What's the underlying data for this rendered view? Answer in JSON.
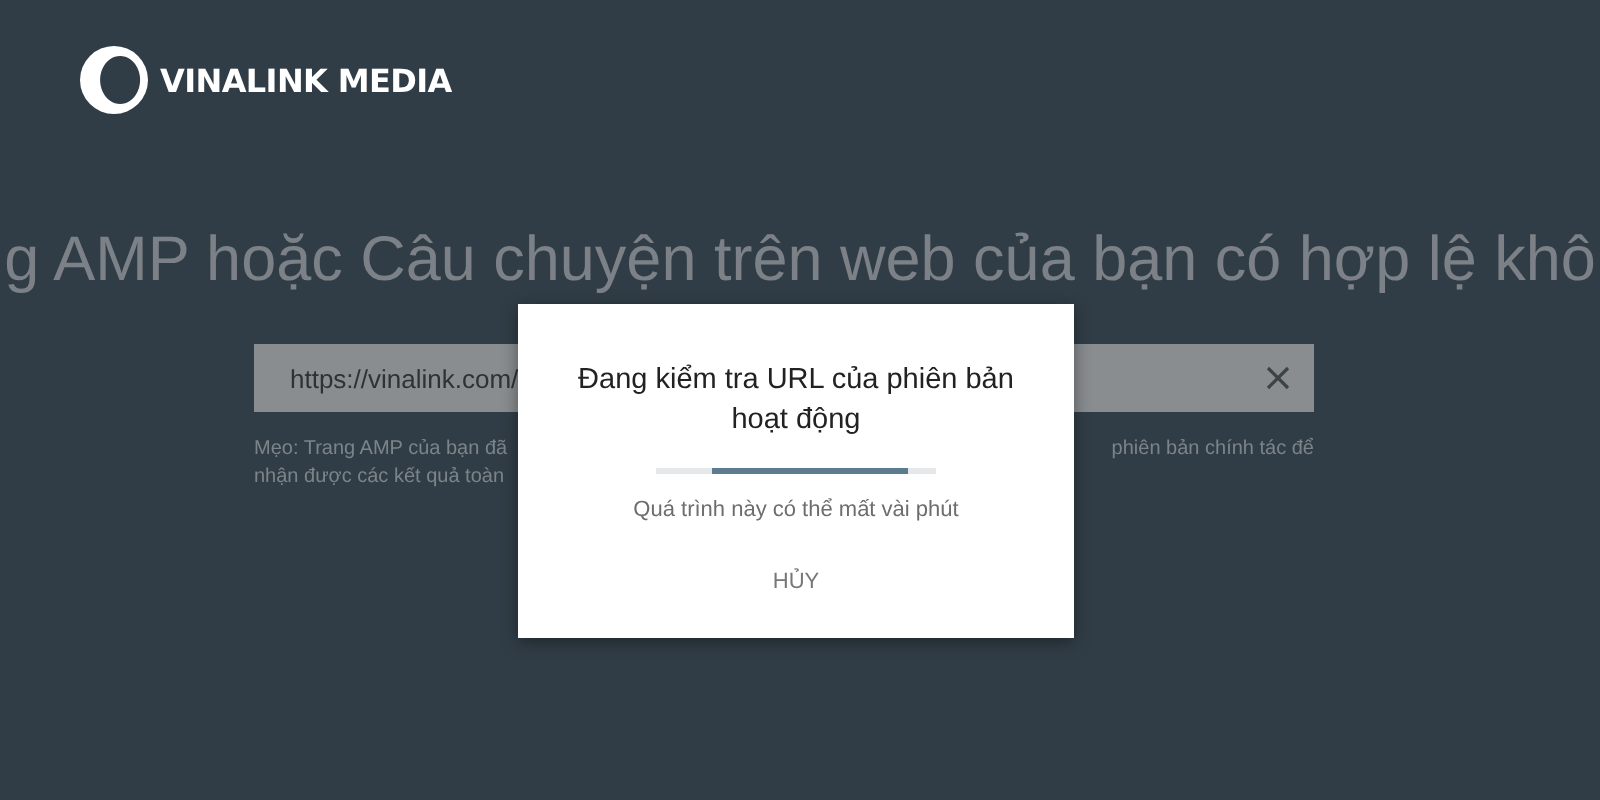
{
  "logo": {
    "text": "VINALINK MEDIA"
  },
  "headline": "g AMP hoặc Câu chuyện trên web của bạn có hợp lệ khô",
  "url_field": {
    "value": "https://vinalink.com/"
  },
  "tip": {
    "left_lines": [
      "Mẹo: Trang AMP của bạn đã",
      "nhận được các kết quả toàn"
    ],
    "right_lines": [
      "phiên bản chính tác để"
    ]
  },
  "dialog": {
    "title": "Đang kiểm tra URL của phiên bản hoạt động",
    "message": "Quá trình này có thể mất vài phút",
    "buttons": [
      "HỦY"
    ]
  }
}
